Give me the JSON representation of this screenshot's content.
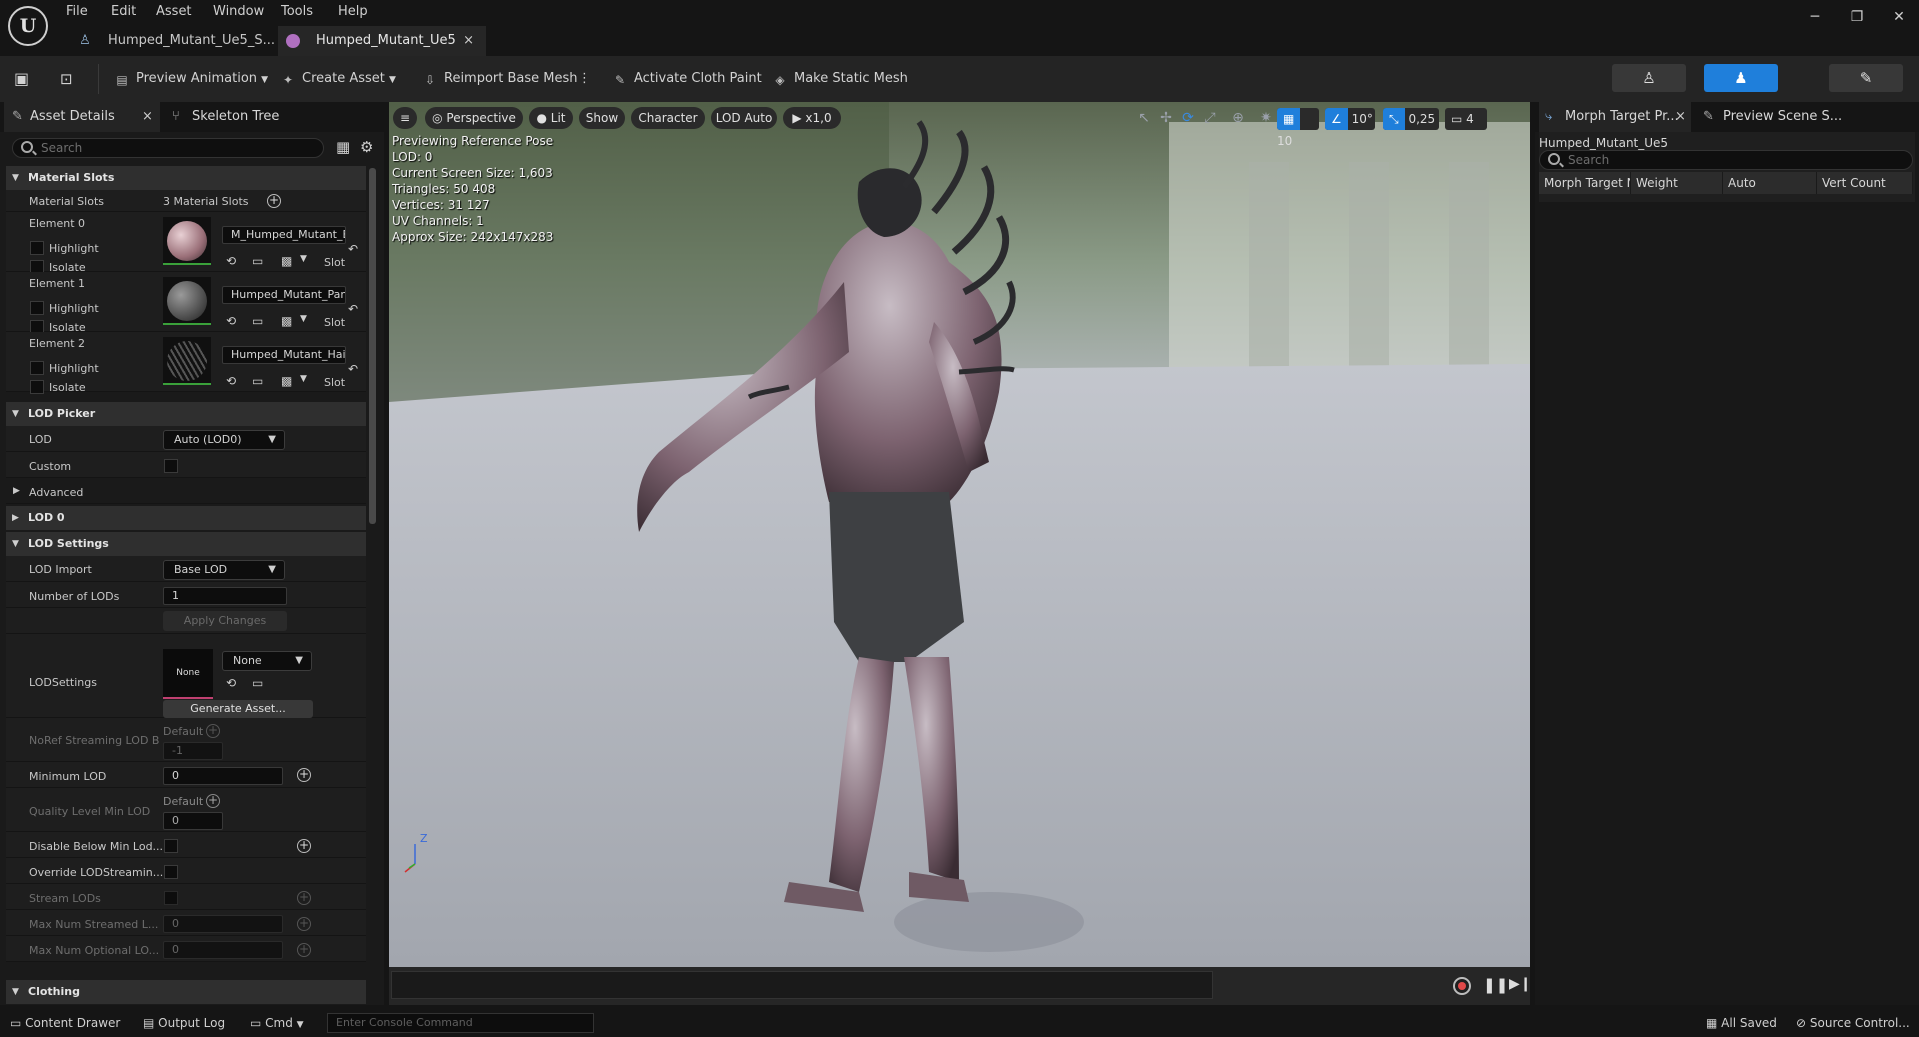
{
  "menu": [
    "File",
    "Edit",
    "Asset",
    "Window",
    "Tools",
    "Help"
  ],
  "tabs": [
    {
      "label": "Humped_Mutant_Ue5_S..."
    },
    {
      "label": "Humped_Mutant_Ue5",
      "close": "×"
    }
  ],
  "window": {
    "minimize": "─",
    "restore": "❐",
    "close": "✕"
  },
  "toolbar": {
    "preview_animation": "Preview Animation",
    "create_asset": "Create Asset",
    "reimport": "Reimport Base Mesh",
    "cloth_paint": "Activate Cloth Paint",
    "static_mesh": "Make Static Mesh"
  },
  "left_panel": {
    "tab_details": "Asset Details",
    "tab_skeleton": "Skeleton Tree",
    "search_placeholder": "Search",
    "material_slots": {
      "section": "Material Slots",
      "label": "Material Slots",
      "count": "3 Material Slots",
      "elements": [
        {
          "name": "Element 0",
          "material": "M_Humped_Mutant_Bo",
          "highlight": "Highlight",
          "isolate": "Isolate",
          "slot": "Slot"
        },
        {
          "name": "Element 1",
          "material": "Humped_Mutant_Pants",
          "highlight": "Highlight",
          "isolate": "Isolate",
          "slot": "Slot"
        },
        {
          "name": "Element 2",
          "material": "Humped_Mutant_Hair",
          "highlight": "Highlight",
          "isolate": "Isolate",
          "slot": "Slot"
        }
      ]
    },
    "lod_picker": {
      "section": "LOD Picker",
      "lod_label": "LOD",
      "lod_value": "Auto (LOD0)",
      "custom_label": "Custom",
      "advanced": "Advanced"
    },
    "lod0": {
      "section": "LOD 0"
    },
    "lod_settings": {
      "section": "LOD Settings",
      "lod_import_label": "LOD Import",
      "lod_import_value": "Base LOD",
      "num_lods_label": "Number of LODs",
      "num_lods_value": "1",
      "apply_changes": "Apply Changes",
      "lodsettings_label": "LODSettings",
      "lodsettings_thumb": "None",
      "lodsettings_value": "None",
      "generate_asset": "Generate Asset...",
      "noref_label": "NoRef Streaming LOD B",
      "noref_default": "Default",
      "noref_value": "-1",
      "min_lod_label": "Minimum LOD",
      "min_lod_value": "0",
      "quality_label": "Quality Level Min LOD",
      "quality_default": "Default",
      "quality_value": "0",
      "disable_below_label": "Disable Below Min Lod...",
      "override_label": "Override LODStreamin...",
      "stream_lods_label": "Stream LODs",
      "max_streamed_label": "Max Num Streamed L...",
      "max_streamed_value": "0",
      "max_optional_label": "Max Num Optional LO...",
      "max_optional_value": "0"
    },
    "clothing": {
      "section": "Clothing"
    }
  },
  "viewport": {
    "perspective": "Perspective",
    "lit": "Lit",
    "show": "Show",
    "character": "Character",
    "lod": "LOD Auto",
    "speed": "x1,0",
    "grid": "10",
    "angle": "10°",
    "scale": "0,25",
    "camera": "4",
    "stats": [
      "Previewing Reference Pose",
      "LOD: 0",
      "Current Screen Size: 1,603",
      "Triangles: 50 408",
      "Vertices: 31 127",
      "UV Channels: 1",
      "Approx Size: 242x147x283"
    ],
    "axis_z": "Z"
  },
  "right_panel": {
    "tab_morph": "Morph Target Pr...",
    "tab_preview": "Preview Scene S...",
    "asset_name": "Humped_Mutant_Ue5",
    "search_placeholder": "Search",
    "columns": [
      "Morph Target N",
      "Weight",
      "Auto",
      "Vert Count"
    ]
  },
  "statusbar": {
    "content_drawer": "Content Drawer",
    "output_log": "Output Log",
    "cmd": "Cmd",
    "console_placeholder": "Enter Console Command",
    "all_saved": "All Saved",
    "source_control": "Source Control..."
  },
  "colors": {
    "accent": "#1f7fdb",
    "record": "#e04848"
  }
}
